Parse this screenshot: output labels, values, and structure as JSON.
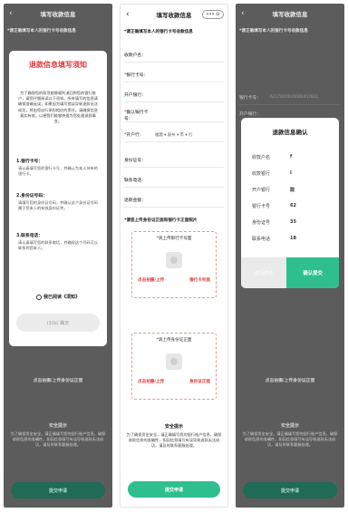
{
  "screen1": {
    "nav": {
      "back": "‹",
      "title": "填写收款信息"
    },
    "warning": "*请正确填写本人的银行卡号收款信息",
    "modal": {
      "title": "退款信息填写须知",
      "lead": "为了确保您的款项能够顺利退回到您的银行账户，请您仔细阅读以下须知。所有填写的信息请确保准确无误，如果因为填写错误导致退款无法成功，将由您自行承担相应的责任。请确保信息真实有效，以便我们能够快速为您处理退款事宜。",
      "items": [
        {
          "head": "1.银行卡号：",
          "text": "请认真填写您的银行卡号，并确认为本人持有的银行卡。"
        },
        {
          "head": "2.身份证号码：",
          "text": "请填写您的身份证号码，并确认这个身份证号码属于您本人的有效身份证件。"
        },
        {
          "head": "3.联系电话：",
          "text": "请认真填写您的联系电话，并确保这个号码可以联系到您本人。"
        }
      ],
      "agree": "我已阅读《须知》",
      "confirm": "(10s) 确定"
    },
    "bottom_upload": "点击拍摄/上传身份证正面",
    "safe_title": "安全提示",
    "safe_text": "为了确保资金安全，请正确填写您的银行账户信息，确保收款信息的准确性，如因信息填写有误导致退款无法成功，请及时联系客服处理。",
    "submit": "提交申请"
  },
  "screen2": {
    "nav": {
      "back": "‹",
      "title": "填写收款信息",
      "caps": "••• ⊙"
    },
    "warning": "*请正确填写本人的银行卡号收款信息",
    "fields": [
      {
        "label": "收款户名：",
        "required": false,
        "value": ""
      },
      {
        "label": "银行卡号：",
        "required": true,
        "value": ""
      },
      {
        "label": "开户银行：",
        "required": false,
        "value": ""
      },
      {
        "label": "确认银行卡号：",
        "required": true,
        "value": ""
      },
      {
        "label": "开户行：",
        "required": true,
        "value": "福建 ▾  泉州 ▾  市 ▾   行"
      },
      {
        "label": "身份证号：",
        "required": false,
        "value": ""
      },
      {
        "label": "联系电话：",
        "required": false,
        "value": ""
      },
      {
        "label": "退款金额：",
        "required": false,
        "value": ""
      }
    ],
    "upload_note": "*请您上传身份证正面和银行卡正面照片",
    "upload1": {
      "caption": "*请上传银行卡号面",
      "action": "点击拍摄/上传",
      "side": "银行卡号面"
    },
    "upload2": {
      "caption": "*请上传身份证正面",
      "action": "点击拍摄/上传",
      "side": "身份证正面"
    },
    "safe_title": "安全提示",
    "safe_text": "为了确保资金安全，请正确填写您的银行账户信息，确保收款信息的准确性，如因信息填写有误导致退款无法成功，请及时联系客服处理。",
    "submit": "提交申请"
  },
  "screen3": {
    "nav": {
      "back": "‹",
      "title": "填写收款信息"
    },
    "warning": "*请正确填写本人的银行卡号收款信息",
    "bg_rows": [
      {
        "label": "银行卡号：",
        "value": "6217001930000457832"
      },
      {
        "label": "开户银行：",
        "value": ""
      }
    ],
    "modal": {
      "title": "退款信息确认",
      "rows": [
        {
          "label": "收款户名",
          "value": "f"
        },
        {
          "label": "收款银行",
          "value": "I"
        },
        {
          "label": "开户银行",
          "value": "陇"
        },
        {
          "label": "银行卡号",
          "value": "62"
        },
        {
          "label": "身份证号",
          "value": "35"
        },
        {
          "label": "联系电话",
          "value": "18"
        }
      ],
      "cancel": "返回修改",
      "ok": "确认提交"
    },
    "bottom_upload": "点击拍摄/上传身份证正面",
    "safe_title": "安全提示",
    "safe_text": "为了确保资金安全，请正确填写您的银行账户信息，确保收款信息的准确性，如因信息填写有误导致退款无法成功，请及时联系客服处理。",
    "submit": "提交申请"
  }
}
